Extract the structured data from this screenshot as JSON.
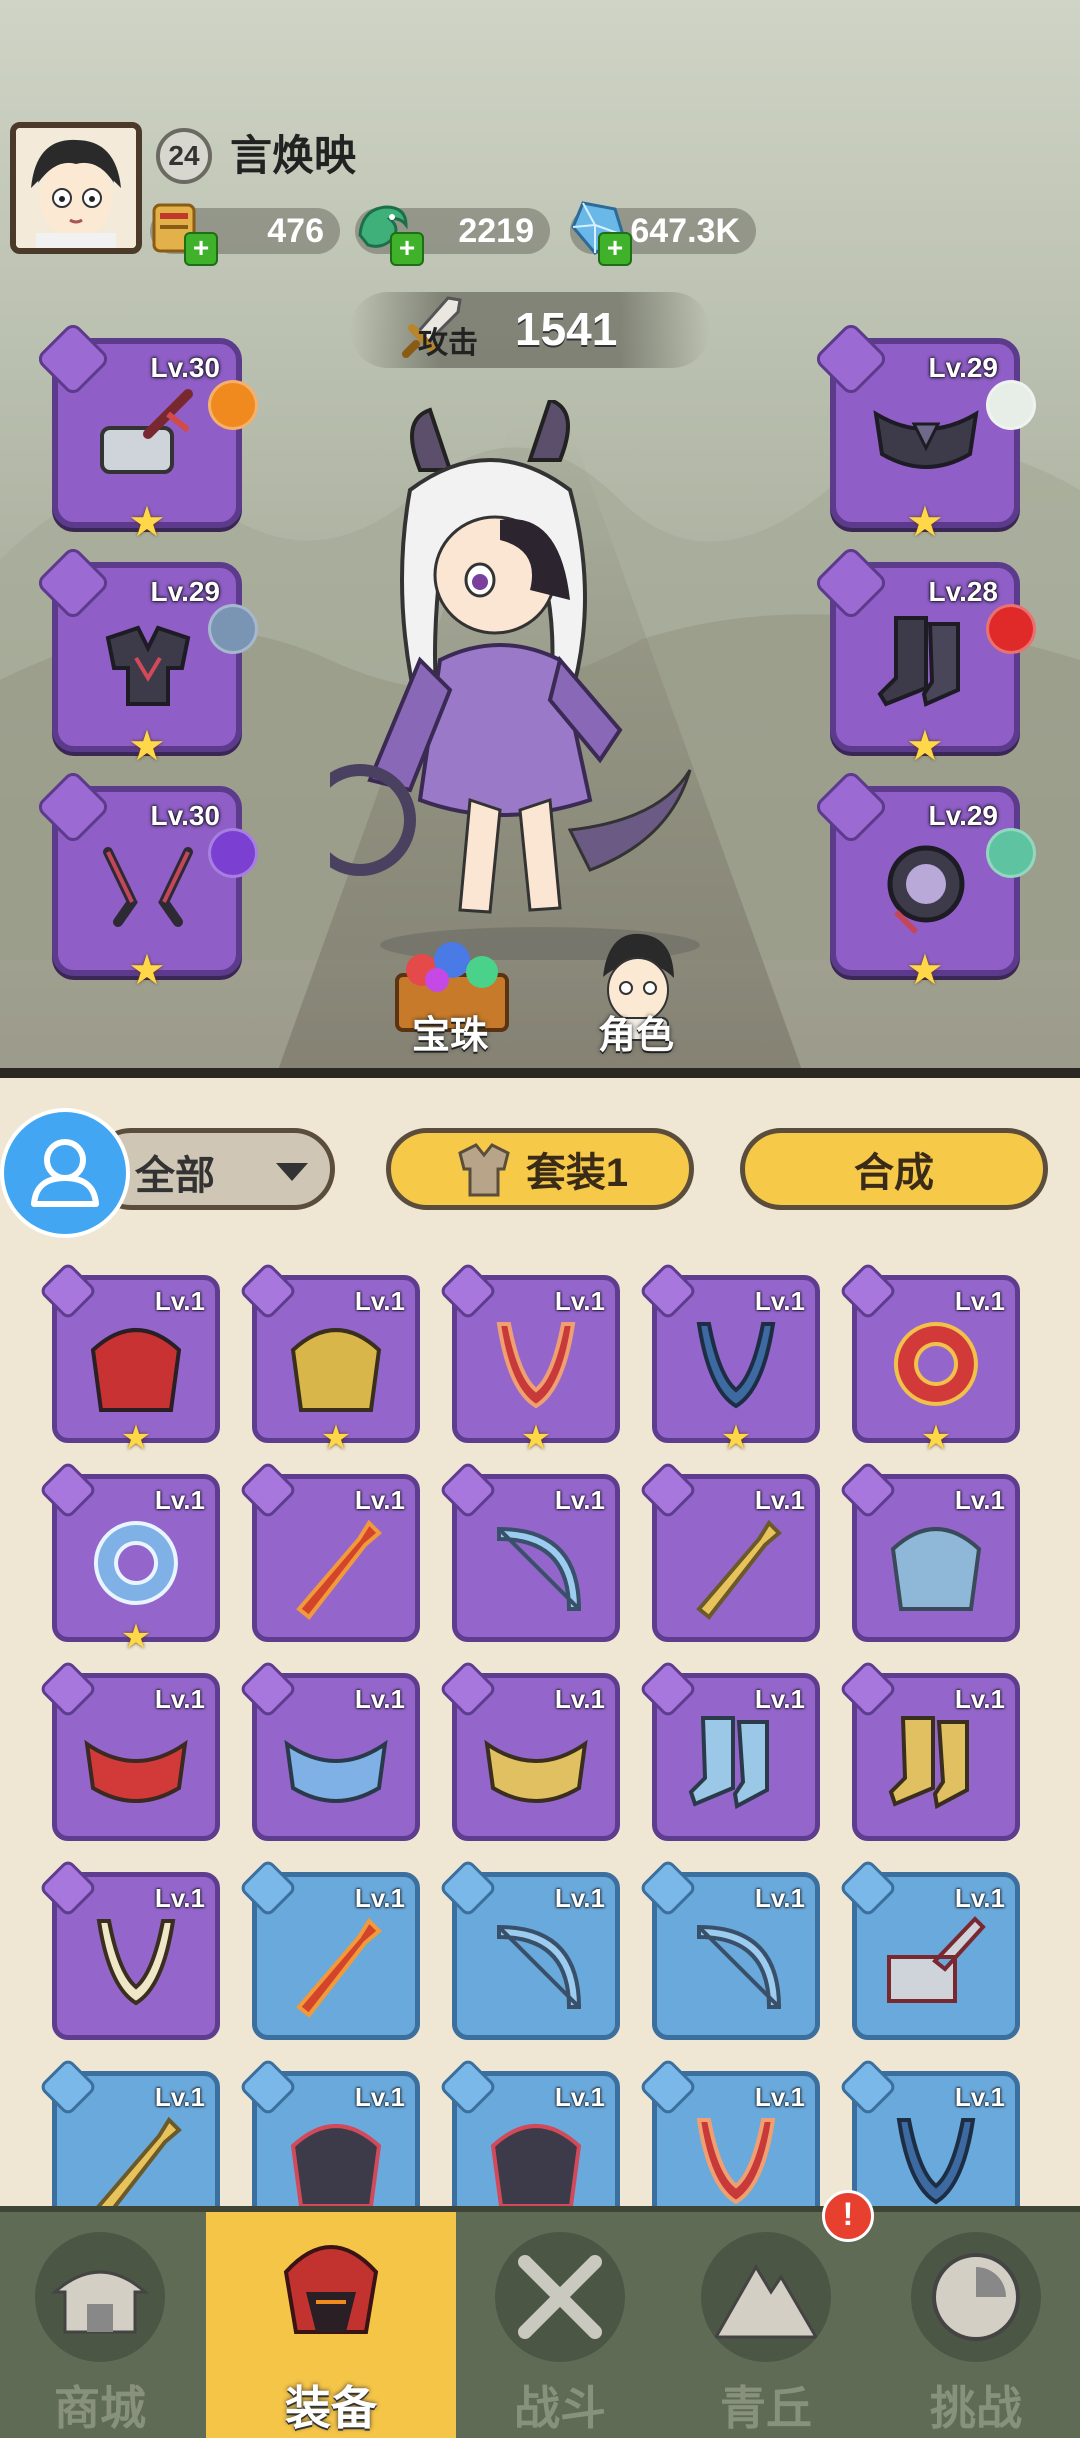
{
  "player": {
    "level": "24",
    "name": "言焕映"
  },
  "resources": [
    {
      "name": "scroll",
      "value": "476"
    },
    {
      "name": "jade-dragon",
      "value": "2219"
    },
    {
      "name": "crystal",
      "value": "647.3K"
    }
  ],
  "attack": {
    "label": "攻击",
    "value": "1541"
  },
  "equipped": [
    {
      "slot": "weapon",
      "level": "Lv.30",
      "orb_color": "#f08a1f"
    },
    {
      "slot": "armor",
      "level": "Lv.29",
      "orb_color": "#7a95b4"
    },
    {
      "slot": "necklace",
      "level": "Lv.30",
      "orb_color": "#7b3fd2"
    },
    {
      "slot": "belt",
      "level": "Lv.29",
      "orb_color": "#e7eee7"
    },
    {
      "slot": "boots",
      "level": "Lv.28",
      "orb_color": "#e02a2a"
    },
    {
      "slot": "ring",
      "level": "Lv.29",
      "orb_color": "#5dc3a0"
    }
  ],
  "bottom_buttons": {
    "orb": "宝珠",
    "character": "角色"
  },
  "toolbar": {
    "filter": "全部",
    "set": "套装1",
    "combine": "合成"
  },
  "inventory": [
    {
      "level": "Lv.1",
      "rarity": "purple",
      "star": true,
      "icon": "helmet-red"
    },
    {
      "level": "Lv.1",
      "rarity": "purple",
      "star": true,
      "icon": "helmet-gold"
    },
    {
      "level": "Lv.1",
      "rarity": "purple",
      "star": true,
      "icon": "necklace-red"
    },
    {
      "level": "Lv.1",
      "rarity": "purple",
      "star": true,
      "icon": "necklace-blue"
    },
    {
      "level": "Lv.1",
      "rarity": "purple",
      "star": true,
      "icon": "ring-red"
    },
    {
      "level": "Lv.1",
      "rarity": "purple",
      "star": true,
      "icon": "ring-blue"
    },
    {
      "level": "Lv.1",
      "rarity": "purple",
      "star": false,
      "icon": "staff-fire"
    },
    {
      "level": "Lv.1",
      "rarity": "purple",
      "star": false,
      "icon": "bow-ice"
    },
    {
      "level": "Lv.1",
      "rarity": "purple",
      "star": false,
      "icon": "staff-gold"
    },
    {
      "level": "Lv.1",
      "rarity": "purple",
      "star": false,
      "icon": "armor-ice"
    },
    {
      "level": "Lv.1",
      "rarity": "purple",
      "star": false,
      "icon": "belt-red"
    },
    {
      "level": "Lv.1",
      "rarity": "purple",
      "star": false,
      "icon": "belt-blue"
    },
    {
      "level": "Lv.1",
      "rarity": "purple",
      "star": false,
      "icon": "belt-gold"
    },
    {
      "level": "Lv.1",
      "rarity": "purple",
      "star": false,
      "icon": "boots-ice"
    },
    {
      "level": "Lv.1",
      "rarity": "purple",
      "star": false,
      "icon": "boots-gold"
    },
    {
      "level": "Lv.1",
      "rarity": "purple",
      "star": false,
      "icon": "necklace-claw"
    },
    {
      "level": "Lv.1",
      "rarity": "blue",
      "star": false,
      "icon": "staff-fire"
    },
    {
      "level": "Lv.1",
      "rarity": "blue",
      "star": false,
      "icon": "bow-ice"
    },
    {
      "level": "Lv.1",
      "rarity": "blue",
      "star": false,
      "icon": "bow-ice"
    },
    {
      "level": "Lv.1",
      "rarity": "blue",
      "star": false,
      "icon": "hammer"
    },
    {
      "level": "Lv.1",
      "rarity": "blue",
      "star": false,
      "icon": "staff-gold"
    },
    {
      "level": "Lv.1",
      "rarity": "blue",
      "star": false,
      "icon": "armor-dark"
    },
    {
      "level": "Lv.1",
      "rarity": "blue",
      "star": false,
      "icon": "armor-dark"
    },
    {
      "level": "Lv.1",
      "rarity": "blue",
      "star": false,
      "icon": "necklace-red"
    },
    {
      "level": "Lv.1",
      "rarity": "blue",
      "star": false,
      "icon": "necklace-blue"
    }
  ],
  "nav": [
    {
      "label": "商城",
      "icon": "shop-icon",
      "active": false,
      "badge": ""
    },
    {
      "label": "装备",
      "icon": "equipment-icon",
      "active": true,
      "badge": ""
    },
    {
      "label": "战斗",
      "icon": "battle-icon",
      "active": false,
      "badge": ""
    },
    {
      "label": "青丘",
      "icon": "mountain-icon",
      "active": false,
      "badge": "!"
    },
    {
      "label": "挑战",
      "icon": "challenge-icon",
      "active": false,
      "badge": ""
    }
  ],
  "colors": {
    "purple": "#9466cc",
    "blue": "#6aa9dc",
    "gold": "#f7c948",
    "nav": "#5f6b55"
  }
}
